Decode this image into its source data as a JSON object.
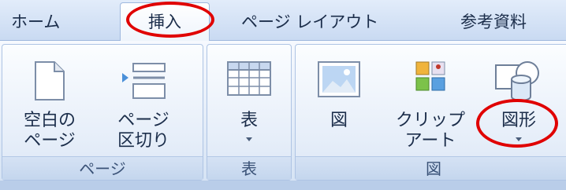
{
  "tabs": [
    {
      "label": "ホーム",
      "active": false
    },
    {
      "label": "挿入",
      "active": true
    },
    {
      "label": "ページ レイアウト",
      "active": false
    },
    {
      "label": "参考資料",
      "active": false
    }
  ],
  "groups": {
    "page": {
      "label": "ページ",
      "blank_page": "空白の\nページ",
      "page_break": "ページ\n区切り"
    },
    "table": {
      "label": "表",
      "table_button": "表"
    },
    "illustration": {
      "label": "図",
      "picture": "図",
      "clipart": "クリップ\nアート",
      "shapes": "図形"
    }
  },
  "colors": {
    "highlight": "#e00000",
    "accent": "#4a90d9"
  }
}
